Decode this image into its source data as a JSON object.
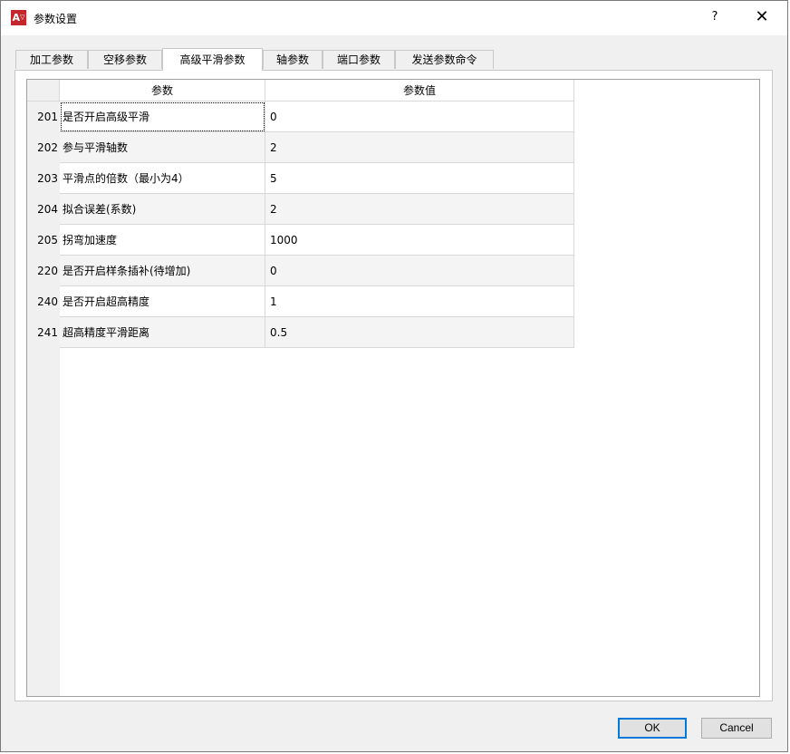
{
  "window": {
    "title": "参数设置",
    "help": "?",
    "close": "✕"
  },
  "tabs": [
    {
      "label": "加工参数"
    },
    {
      "label": "空移参数"
    },
    {
      "label": "高级平滑参数"
    },
    {
      "label": "轴参数"
    },
    {
      "label": "端口参数"
    },
    {
      "label": "发送参数命令"
    }
  ],
  "active_tab": "高级平滑参数",
  "table": {
    "headers": {
      "name": "参数",
      "value": "参数值"
    },
    "rows": [
      {
        "id": "201",
        "name": "是否开启高级平滑",
        "value": "0"
      },
      {
        "id": "202",
        "name": "参与平滑轴数",
        "value": "2"
      },
      {
        "id": "203",
        "name": "平滑点的倍数（最小为4）",
        "value": "5"
      },
      {
        "id": "204",
        "name": "拟合误差(系数)",
        "value": "2"
      },
      {
        "id": "205",
        "name": "拐弯加速度",
        "value": "1000"
      },
      {
        "id": "220",
        "name": "是否开启样条插补(待增加)",
        "value": "0"
      },
      {
        "id": "240",
        "name": "是否开启超高精度",
        "value": "1"
      },
      {
        "id": "241",
        "name": "超高精度平滑距离",
        "value": "0.5"
      }
    ]
  },
  "buttons": {
    "ok": "OK",
    "cancel": "Cancel"
  }
}
